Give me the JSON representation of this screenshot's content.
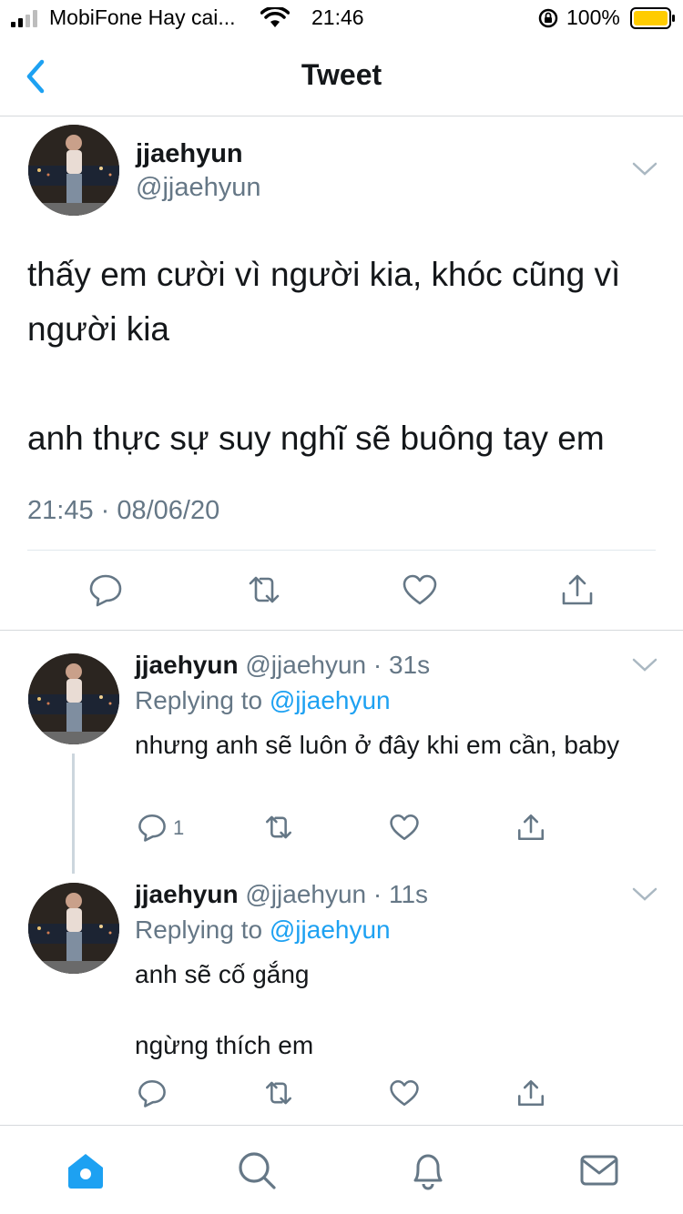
{
  "status_bar": {
    "carrier": "MobiFone Hay cai...",
    "time": "21:46",
    "battery_percent": "100%",
    "battery_level": 1.0,
    "icons": [
      "signal-icon",
      "wifi-icon",
      "rotation-lock-icon",
      "battery-icon"
    ]
  },
  "nav": {
    "title": "Tweet",
    "back_icon": "chevron-left-icon"
  },
  "main_tweet": {
    "name": "jjaehyun",
    "handle": "@jjaehyun",
    "text": "thấy em cười vì người kia, khóc cũng vì người kia\n\nanh thực sự suy nghĩ sẽ buông tay em",
    "timestamp": "21:45 · 08/06/20",
    "actions": [
      "reply-icon",
      "retweet-icon",
      "like-icon",
      "share-icon"
    ]
  },
  "replies": [
    {
      "name": "jjaehyun",
      "handle": "@jjaehyun",
      "meta": "@jjaehyun · 31s",
      "replying_prefix": "Replying to ",
      "replying_to": "@jjaehyun",
      "text": "nhưng anh sẽ luôn ở đây khi em cần, baby",
      "reply_count": "1"
    },
    {
      "name": "jjaehyun",
      "handle": "@jjaehyun",
      "meta": "@jjaehyun · 11s",
      "replying_prefix": "Replying to ",
      "replying_to": "@jjaehyun",
      "text": "anh sẽ cố gắng\n\nngừng thích em",
      "reply_count": ""
    }
  ],
  "tab_bar": {
    "items": [
      "home-icon",
      "search-icon",
      "notifications-icon",
      "messages-icon"
    ],
    "active": "home-icon"
  },
  "colors": {
    "accent": "#1da1f2",
    "text": "#14171a",
    "secondary": "#657786",
    "battery": "#ffcc00"
  }
}
